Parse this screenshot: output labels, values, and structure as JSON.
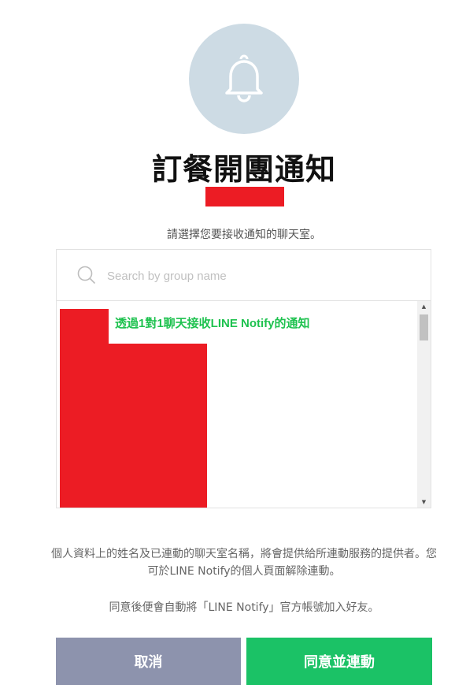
{
  "header": {
    "icon": "bell-icon",
    "title": "訂餐開團通知"
  },
  "instruction": "請選擇您要接收通知的聊天室。",
  "search": {
    "placeholder": "Search by group name",
    "icon": "search-icon"
  },
  "chat_list": {
    "items": [
      {
        "label": "透過1對1聊天接收LINE Notify的通知"
      }
    ]
  },
  "disclaimer": "個人資料上的姓名及已連動的聊天室名稱，將會提供給所連動服務的提供者。您可於LINE Notify的個人頁面解除連動。",
  "agree_note": "同意後便會自動將「LINE Notify」官方帳號加入好友。",
  "buttons": {
    "cancel": "取消",
    "agree": "同意並連動"
  },
  "colors": {
    "accent_green": "#1bc266",
    "cancel_gray": "#8d93ad",
    "bell_circle": "#cddbe4",
    "redaction": "#ec1c24"
  }
}
